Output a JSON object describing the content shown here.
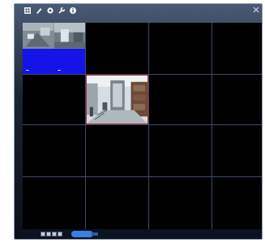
{
  "toolbar": {
    "icons": [
      "grid-view-icon",
      "pen-icon",
      "settings-icon",
      "wrench-icon",
      "info-icon"
    ],
    "close_icon": "close-icon"
  },
  "grid": {
    "rows": 4,
    "columns": 4,
    "selected_cell": 6,
    "quad_blue_label": "",
    "cells": [
      {
        "id": 1,
        "content": "quad-preview"
      },
      {
        "id": 2,
        "content": "empty"
      },
      {
        "id": 3,
        "content": "empty"
      },
      {
        "id": 4,
        "content": "empty"
      },
      {
        "id": 5,
        "content": "empty"
      },
      {
        "id": 6,
        "content": "camera-feed"
      },
      {
        "id": 7,
        "content": "empty"
      },
      {
        "id": 8,
        "content": "empty"
      },
      {
        "id": 9,
        "content": "empty"
      },
      {
        "id": 10,
        "content": "empty"
      },
      {
        "id": 11,
        "content": "empty"
      },
      {
        "id": 12,
        "content": "empty"
      },
      {
        "id": 13,
        "content": "empty"
      },
      {
        "id": 14,
        "content": "empty"
      },
      {
        "id": 15,
        "content": "empty"
      },
      {
        "id": 16,
        "content": "empty"
      }
    ]
  },
  "bottom_bar": {
    "layout_buttons": [
      "layout-1x1-button",
      "layout-2x2-button",
      "layout-3x3-button",
      "layout-4x4-button"
    ],
    "mode_label": ""
  },
  "colors": {
    "frame": "#1b2433",
    "grid_line": "#3b4a6a",
    "selected_border": "#c0272d",
    "no_signal_blue": "#1414e8",
    "mode_button": "#3d7ee0"
  }
}
